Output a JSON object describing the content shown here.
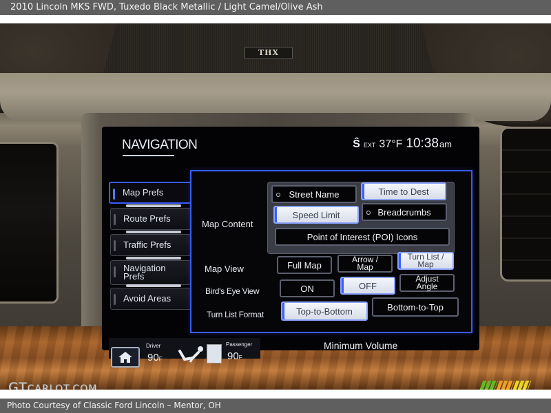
{
  "header": {
    "title": "2010 Lincoln MKS FWD,  Tuxedo Black Metallic / Light Camel/Olive Ash"
  },
  "footer": {
    "credit": "Photo Courtesy of Classic Ford Lincoln – Mentor, OH",
    "watermark_main": "GT",
    "watermark_rest": "CARLOT.COM",
    "logo_colors": [
      "#5bbf22",
      "#f0a020",
      "#e8d820"
    ]
  },
  "dashboard": {
    "speaker_badge": "THX"
  },
  "screen": {
    "title": "NAVIGATION",
    "status": {
      "satellite_icon": "sirius-icon",
      "satellite_glyph": "Ŝ",
      "ext_label": "EXT",
      "temperature": "37°F",
      "time": "10:38",
      "ampm": "am"
    },
    "tabs": [
      {
        "label": "Map Prefs",
        "active": true
      },
      {
        "label": "Route Prefs",
        "active": false
      },
      {
        "label": "Traffic Prefs",
        "active": false
      },
      {
        "label": "Navigation Prefs",
        "active": false
      },
      {
        "label": "Avoid Areas",
        "active": false
      }
    ],
    "map_content": {
      "label": "Map Content",
      "options": [
        {
          "label": "Street Name",
          "selected": false
        },
        {
          "label": "Time to Dest",
          "selected": true
        },
        {
          "label": "Speed Limit",
          "selected": true
        },
        {
          "label": "Breadcrumbs",
          "selected": false
        },
        {
          "label": "Point of Interest (POI) Icons",
          "selected": false
        }
      ]
    },
    "map_view": {
      "label": "Map View",
      "options": [
        {
          "label": "Full Map",
          "selected": false
        },
        {
          "label": "Arrow / Map",
          "selected": false
        },
        {
          "label": "Turn List / Map",
          "selected": true
        }
      ]
    },
    "birds_eye_view": {
      "label": "Bird's Eye View",
      "options": [
        {
          "label": "ON",
          "selected": false
        },
        {
          "label": "OFF",
          "selected": true
        },
        {
          "label": "Adjust Angle",
          "selected": false
        }
      ]
    },
    "turn_list_format": {
      "label": "Turn List Format",
      "options": [
        {
          "label": "Top-to-Bottom",
          "selected": true
        },
        {
          "label": "Bottom-to-Top",
          "selected": false
        }
      ]
    },
    "climate": {
      "driver_label": "Driver",
      "driver_temp": "90",
      "driver_unit": "F",
      "passenger_label": "Passenger",
      "passenger_temp": "90",
      "passenger_unit": "F"
    },
    "volume_status": "Minimum Volume"
  },
  "colors": {
    "accent_blue": "#3a5cff",
    "selected_button": "#e8ecf4",
    "screen_bg": "#030305"
  }
}
